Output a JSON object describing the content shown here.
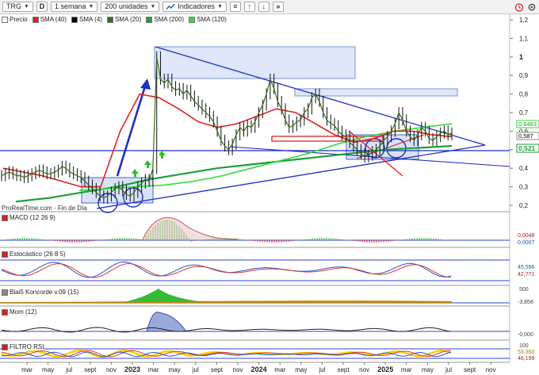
{
  "toolbar": {
    "symbol": "TRG",
    "d_button": "D",
    "period": "1 semana",
    "units": "200 unidades",
    "indicators": "Indicadores",
    "menu_glyph": "≡",
    "up_glyph": "↑",
    "down_glyph": "↓",
    "more_glyph": "»"
  },
  "legend": [
    {
      "label": "Precio",
      "color": "#ffffff"
    },
    {
      "label": "SMA (40)",
      "color": "#e02020"
    },
    {
      "label": "SMA (4)",
      "color": "#000000"
    },
    {
      "label": "SMA (20)",
      "color": "#3a6b1a"
    },
    {
      "label": "SMA (200)",
      "color": "#1e9e3a"
    },
    {
      "label": "SMA (120)",
      "color": "#33dd33"
    }
  ],
  "source_label": "ProRealTime.com - Fin de Día",
  "panes": {
    "macd": {
      "label": "MACD (12 26 9)",
      "v1": "0,0048",
      "v2": "0,0007"
    },
    "stoch": {
      "label": "Estocástico (26 8 5)",
      "v1": "45,596",
      "v2": "42,771"
    },
    "koncorde": {
      "label": "Blai5 Koncorde v.09 (15)",
      "tick": "500",
      "v1": "-3,858"
    },
    "mom": {
      "label": "Mom (12)",
      "v1": "-0,000"
    },
    "rsi": {
      "label": "FILTRO RSI",
      "tick": "100",
      "v1": "53,360",
      "v2": "48,199"
    }
  },
  "chart_data": {
    "type": "line",
    "title": "TRG",
    "y_axis_ticks": [
      "1,2",
      "1,1",
      "1",
      "0,9",
      "0,8",
      "0,7",
      "0,6",
      "0,5",
      "0,4",
      "0,3",
      "0,2"
    ],
    "ylim": [
      0.18,
      1.22
    ],
    "x_axis_ticks": [
      "mar",
      "may",
      "jul",
      "sept",
      "nov",
      "2023",
      "mar",
      "may",
      "jul",
      "sept",
      "nov",
      "2024",
      "mar",
      "may",
      "jul",
      "sept",
      "nov",
      "2025",
      "mar",
      "may",
      "jul",
      "sept",
      "nov"
    ],
    "last_values": {
      "price": "0,587",
      "sma_a": "0,6463",
      "sma_b": "0,521"
    },
    "price_series": [
      0.36,
      0.37,
      0.38,
      0.37,
      0.36,
      0.36,
      0.35,
      0.36,
      0.37,
      0.38,
      0.39,
      0.38,
      0.37,
      0.37,
      0.38,
      0.39,
      0.41,
      0.4,
      0.38,
      0.37,
      0.36,
      0.35,
      0.33,
      0.31,
      0.29,
      0.27,
      0.25,
      0.24,
      0.25,
      0.27,
      0.29,
      0.3,
      0.28,
      0.26,
      0.25,
      0.27,
      0.3,
      0.32,
      0.34,
      0.33,
      0.4,
      1.0,
      0.88,
      0.86,
      0.88,
      0.84,
      0.82,
      0.83,
      0.8,
      0.82,
      0.79,
      0.76,
      0.74,
      0.72,
      0.7,
      0.68,
      0.65,
      0.6,
      0.55,
      0.52,
      0.5,
      0.53,
      0.58,
      0.62,
      0.6,
      0.63,
      0.62,
      0.65,
      0.7,
      0.74,
      0.8,
      0.88,
      0.83,
      0.76,
      0.72,
      0.66,
      0.62,
      0.63,
      0.65,
      0.66,
      0.7,
      0.72,
      0.78,
      0.8,
      0.76,
      0.7,
      0.66,
      0.64,
      0.63,
      0.6,
      0.58,
      0.57,
      0.54,
      0.52,
      0.5,
      0.48,
      0.46,
      0.47,
      0.49,
      0.5,
      0.52,
      0.55,
      0.57,
      0.6,
      0.64,
      0.7,
      0.66,
      0.6,
      0.57,
      0.55,
      0.58,
      0.62,
      0.6,
      0.56,
      0.55,
      0.57,
      0.59,
      0.6,
      0.58,
      0.59
    ],
    "sma120": [
      0.28,
      0.29,
      0.3,
      0.31,
      0.33,
      0.36,
      0.4,
      0.44,
      0.48,
      0.53,
      0.57,
      0.6,
      0.62,
      0.64
    ],
    "sma200": [
      0.22,
      0.24,
      0.27,
      0.3,
      0.34,
      0.37,
      0.4,
      0.42,
      0.44,
      0.46,
      0.48,
      0.5,
      0.51,
      0.52
    ],
    "sma40": [
      0.4,
      0.38,
      0.36,
      0.33,
      0.3,
      0.3,
      0.6,
      0.8,
      0.78,
      0.72,
      0.65,
      0.62,
      0.64,
      0.68,
      0.72,
      0.7,
      0.64,
      0.58,
      0.54,
      0.56,
      0.6,
      0.6,
      0.58,
      0.57
    ]
  }
}
